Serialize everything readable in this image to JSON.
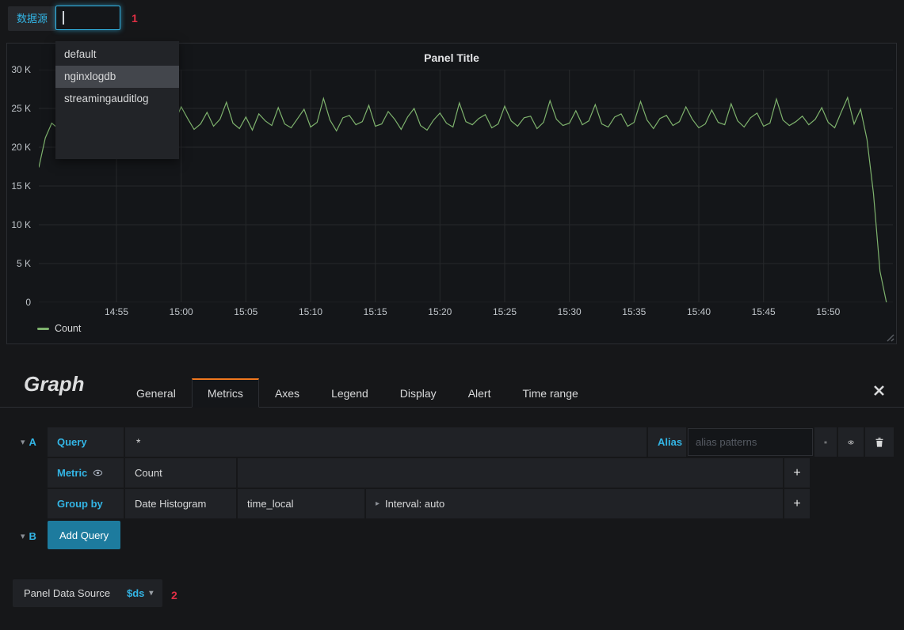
{
  "annotations": {
    "marker_1": "1",
    "marker_2": "2",
    "color": "#e02f44"
  },
  "topbar": {
    "datasource_label": "数据源",
    "search_value": "",
    "dropdown": {
      "items": [
        {
          "label": "default",
          "highlighted": false
        },
        {
          "label": "nginxlogdb",
          "highlighted": true
        },
        {
          "label": "streamingauditlog",
          "highlighted": false
        }
      ]
    }
  },
  "panel": {
    "title": "Panel Title",
    "legend": [
      {
        "label": "Count",
        "color": "#7eb26d"
      }
    ]
  },
  "chart_data": {
    "type": "line",
    "title": "Panel Title",
    "x_domain": [
      "14:49",
      "15:55"
    ],
    "x_ticks": [
      "14:55",
      "15:00",
      "15:05",
      "15:10",
      "15:15",
      "15:20",
      "15:25",
      "15:30",
      "15:35",
      "15:40",
      "15:45",
      "15:50"
    ],
    "ylim": [
      0,
      30000
    ],
    "y_ticks": [
      {
        "value": 0,
        "label": "0"
      },
      {
        "value": 5000,
        "label": "5 K"
      },
      {
        "value": 10000,
        "label": "10 K"
      },
      {
        "value": 15000,
        "label": "15 K"
      },
      {
        "value": 20000,
        "label": "20 K"
      },
      {
        "value": 25000,
        "label": "25 K"
      },
      {
        "value": 30000,
        "label": "30 K"
      }
    ],
    "grid": true,
    "legend_position": "bottom-left",
    "series": [
      {
        "name": "Count",
        "color": "#7eb26d",
        "start_time": "14:49",
        "interval_seconds": 30,
        "values": [
          17400,
          21200,
          23100,
          22400,
          24800,
          23000,
          22200,
          23900,
          25600,
          22800,
          22100,
          23500,
          24200,
          22600,
          23800,
          26100,
          23200,
          22500,
          24000,
          22900,
          21800,
          23300,
          25200,
          23700,
          22300,
          23000,
          24500,
          22700,
          23600,
          25800,
          23100,
          22400,
          23900,
          22200,
          24300,
          23400,
          22800,
          25100,
          23000,
          22500,
          23700,
          24900,
          22600,
          23200,
          26300,
          23500,
          22100,
          23800,
          24100,
          22900,
          23300,
          25400,
          22700,
          23000,
          24600,
          23600,
          22300,
          23900,
          25000,
          22800,
          22200,
          23500,
          24400,
          23100,
          22600,
          25700,
          23300,
          22900,
          23700,
          24200,
          22500,
          23000,
          25300,
          23400,
          22700,
          23800,
          24000,
          22400,
          23200,
          26000,
          23600,
          22800,
          23100,
          24700,
          22900,
          23400,
          25500,
          23000,
          22600,
          23900,
          24300,
          22700,
          23200,
          25900,
          23500,
          22400,
          23700,
          24100,
          22800,
          23300,
          25200,
          23600,
          22500,
          23000,
          24800,
          23200,
          22900,
          25600,
          23400,
          22600,
          23800,
          24400,
          22700,
          23100,
          26200,
          23500,
          22800,
          23300,
          24000,
          22900,
          23600,
          25100,
          23200,
          22500,
          24500,
          26400,
          23000,
          24900,
          21000,
          14000,
          4000,
          0
        ]
      }
    ]
  },
  "editor": {
    "title": "Graph",
    "tabs": [
      {
        "label": "General",
        "active": false
      },
      {
        "label": "Metrics",
        "active": true
      },
      {
        "label": "Axes",
        "active": false
      },
      {
        "label": "Legend",
        "active": false
      },
      {
        "label": "Display",
        "active": false
      },
      {
        "label": "Alert",
        "active": false
      },
      {
        "label": "Time range",
        "active": false
      }
    ],
    "query_row": {
      "letter": "A",
      "query_label": "Query",
      "query_value": "*",
      "alias_label": "Alias",
      "alias_placeholder": "alias patterns"
    },
    "metric_row": {
      "label": "Metric",
      "value": "Count",
      "add_label": "+"
    },
    "groupby_row": {
      "label": "Group by",
      "type": "Date Histogram",
      "field": "time_local",
      "interval": "Interval: auto",
      "add_label": "+"
    },
    "add_row": {
      "letter": "B",
      "button_label": "Add Query"
    },
    "footer": {
      "datasource_button": "Panel Data Source",
      "variable_value": "$ds"
    }
  }
}
